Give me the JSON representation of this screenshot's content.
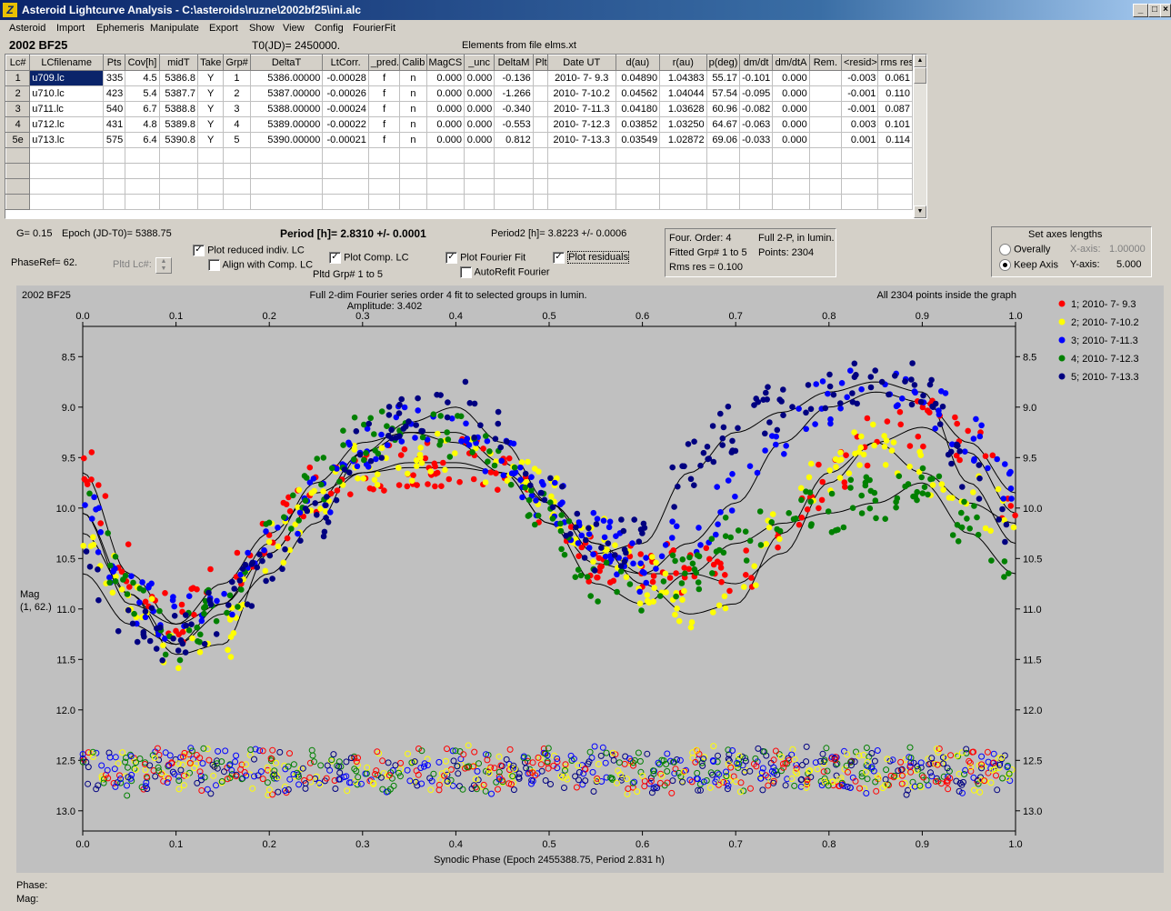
{
  "window": {
    "title": "Asteroid Lightcurve Analysis - C:\\asteroids\\ruzne\\2002bf25\\ini.alc",
    "icon": "app-icon",
    "minimize": "_",
    "maximize": "□",
    "close": "×"
  },
  "menu": [
    "Asteroid",
    "Import",
    "Ephemeris",
    "Manipulate",
    "Export",
    "Show",
    "View",
    "Config",
    "FourierFit"
  ],
  "header": {
    "asteroid": "2002 BF25",
    "t0": "T0(JD)= 2450000.",
    "elements": "Elements from file elms.xt"
  },
  "table": {
    "columns": [
      "Lc#",
      "LCfilename",
      "Pts",
      "Cov[h]",
      "midT",
      "Take",
      "Grp#",
      "DeltaT",
      "LtCorr.",
      "_pred.",
      "Calib",
      "MagCS",
      "_unc",
      "DeltaM",
      "Plt",
      "Date UT",
      "d(au)",
      "r(au)",
      "p(deg)",
      "dm/dt",
      "dm/dtA",
      "Rem.",
      "<resid>",
      "rms res"
    ],
    "rows": [
      [
        "1",
        "u709.lc",
        "335",
        "4.5",
        "5386.8",
        "Y",
        "1",
        "5386.00000",
        "-0.00028",
        "f",
        "n",
        "0.000",
        "0.000",
        "-0.136",
        "",
        "2010- 7- 9.3",
        "0.04890",
        "1.04383",
        "55.17",
        "-0.101",
        "0.000",
        "",
        "-0.003",
        "0.061"
      ],
      [
        "2",
        "u710.lc",
        "423",
        "5.4",
        "5387.7",
        "Y",
        "2",
        "5387.00000",
        "-0.00026",
        "f",
        "n",
        "0.000",
        "0.000",
        "-1.266",
        "",
        "2010- 7-10.2",
        "0.04562",
        "1.04044",
        "57.54",
        "-0.095",
        "0.000",
        "",
        "-0.001",
        "0.110"
      ],
      [
        "3",
        "u711.lc",
        "540",
        "6.7",
        "5388.8",
        "Y",
        "3",
        "5388.00000",
        "-0.00024",
        "f",
        "n",
        "0.000",
        "0.000",
        "-0.340",
        "",
        "2010- 7-11.3",
        "0.04180",
        "1.03628",
        "60.96",
        "-0.082",
        "0.000",
        "",
        "-0.001",
        "0.087"
      ],
      [
        "4",
        "u712.lc",
        "431",
        "4.8",
        "5389.8",
        "Y",
        "4",
        "5389.00000",
        "-0.00022",
        "f",
        "n",
        "0.000",
        "0.000",
        "-0.553",
        "",
        "2010- 7-12.3",
        "0.03852",
        "1.03250",
        "64.67",
        "-0.063",
        "0.000",
        "",
        "0.003",
        "0.101"
      ],
      [
        "5e",
        "u713.lc",
        "575",
        "6.4",
        "5390.8",
        "Y",
        "5",
        "5390.00000",
        "-0.00021",
        "f",
        "n",
        "0.000",
        "0.000",
        "0.812",
        "",
        "2010- 7-13.3",
        "0.03549",
        "1.02872",
        "69.06",
        "-0.033",
        "0.000",
        "",
        "0.001",
        "0.114"
      ]
    ],
    "empty_rows": 4
  },
  "controls": {
    "g": "G= 0.15",
    "epoch": "Epoch (JD-T0)= 5388.75",
    "period": "Period [h]= 2.8310 +/- 0.0001",
    "period2": "Period2 [h]= 3.8223 +/- 0.0006",
    "phaseref": "PhaseRef= 62.",
    "pltd_lc": "Pltd Lc#:",
    "plot_reduced": "Plot reduced indiv. LC",
    "align_comp": "Align with Comp. LC",
    "plot_comp": "Plot Comp. LC",
    "pltd_grp": "Pltd Grp#  1   to   5",
    "plot_fourier": "Plot Fourier Fit",
    "autorefit": "AutoRefit Fourier",
    "plot_residuals": "Plot residuals",
    "four_order": "Four. Order:  4",
    "full2p": "Full 2-P, in lumin.",
    "fitted": "Fitted Grp# 1 to 5",
    "points": "Points: 2304",
    "rms": "Rms res      = 0.100",
    "axes_title": "Set axes lengths",
    "overally": "Overally",
    "keep_axis": "Keep Axis",
    "xaxis_label": "X-axis:",
    "xaxis_val": "1.00000",
    "yaxis_label": "Y-axis:",
    "yaxis_val": "5.000"
  },
  "footer": {
    "phase": "Phase:",
    "mag": "Mag:"
  },
  "chart_data": {
    "type": "scatter",
    "corner_label": "2002 BF25",
    "title": "Full 2-dim Fourier series order 4 fit to selected groups in lumin.",
    "subtitle": "Amplitude: 3.402",
    "note": "All 2304 points inside the graph",
    "xlabel": "Synodic Phase (Epoch 2455388.75, Period 2.831 h)",
    "ylabel": "Mag\n(1, 62.)",
    "xlim": [
      0.0,
      1.0
    ],
    "ylim": [
      13.2,
      8.2
    ],
    "x_ticks": [
      "0.0",
      "0.1",
      "0.2",
      "0.3",
      "0.4",
      "0.5",
      "0.6",
      "0.7",
      "0.8",
      "0.9",
      "1.0"
    ],
    "y_ticks": [
      "8.5",
      "9.0",
      "9.5",
      "10.0",
      "10.5",
      "11.0",
      "11.5",
      "12.0",
      "12.5",
      "13.0"
    ],
    "residual_level": 12.6,
    "series": [
      {
        "name": "1; 2010- 7- 9.3",
        "color": "#ff0000",
        "x": [
          0.0,
          0.05,
          0.1,
          0.15,
          0.2,
          0.25,
          0.3,
          0.35,
          0.4,
          0.45,
          0.5,
          0.55,
          0.6,
          0.65,
          0.7,
          0.75,
          0.8,
          0.85,
          0.9,
          0.95,
          1.0
        ],
        "y": [
          9.6,
          10.6,
          11.1,
          10.7,
          10.2,
          9.8,
          9.6,
          9.55,
          9.55,
          9.6,
          10.1,
          10.5,
          10.6,
          10.6,
          10.7,
          10.4,
          9.7,
          9.3,
          9.15,
          9.4,
          10.0
        ]
      },
      {
        "name": "2; 2010- 7-10.2",
        "color": "#ffff00",
        "x": [
          0.0,
          0.05,
          0.1,
          0.15,
          0.2,
          0.25,
          0.3,
          0.35,
          0.4,
          0.45,
          0.5,
          0.55,
          0.6,
          0.65,
          0.7,
          0.75,
          0.8,
          0.85,
          0.9,
          0.95,
          1.0
        ],
        "y": [
          10.2,
          10.8,
          11.4,
          11.3,
          10.4,
          9.9,
          9.6,
          9.5,
          9.5,
          9.6,
          9.9,
          10.3,
          10.7,
          11.0,
          10.9,
          10.2,
          9.6,
          9.3,
          9.6,
          9.9,
          10.1
        ]
      },
      {
        "name": "3; 2010- 7-11.3",
        "color": "#0000ff",
        "x": [
          0.0,
          0.05,
          0.1,
          0.15,
          0.2,
          0.25,
          0.3,
          0.35,
          0.4,
          0.45,
          0.5,
          0.55,
          0.6,
          0.65,
          0.7,
          0.75,
          0.8,
          0.85,
          0.9,
          0.95,
          1.0
        ],
        "y": [
          10.0,
          10.9,
          11.1,
          10.9,
          10.4,
          9.9,
          9.4,
          9.2,
          9.2,
          9.5,
          9.9,
          10.3,
          10.6,
          10.3,
          9.9,
          9.3,
          8.95,
          8.8,
          8.9,
          9.3,
          9.8
        ]
      },
      {
        "name": "4; 2010- 7-12.3",
        "color": "#008000",
        "x": [
          0.0,
          0.05,
          0.1,
          0.15,
          0.2,
          0.25,
          0.3,
          0.35,
          0.4,
          0.45,
          0.5,
          0.55,
          0.6,
          0.65,
          0.7,
          0.75,
          0.8,
          0.85,
          0.9,
          0.95,
          1.0
        ],
        "y": [
          10.0,
          10.8,
          11.3,
          10.9,
          10.3,
          9.7,
          9.3,
          9.2,
          9.3,
          9.6,
          10.1,
          10.7,
          10.9,
          10.6,
          10.3,
          10.1,
          10.0,
          9.9,
          9.7,
          10.2,
          10.6
        ]
      },
      {
        "name": "5; 2010- 7-13.3",
        "color": "#000080",
        "x": [
          0.0,
          0.05,
          0.1,
          0.15,
          0.2,
          0.25,
          0.3,
          0.35,
          0.4,
          0.45,
          0.5,
          0.55,
          0.6,
          0.65,
          0.7,
          0.75,
          0.8,
          0.85,
          0.9,
          0.95,
          1.0
        ],
        "y": [
          10.6,
          11.1,
          11.3,
          11.0,
          10.6,
          10.1,
          9.4,
          9.1,
          8.95,
          9.3,
          9.9,
          10.4,
          10.3,
          9.6,
          9.2,
          9.0,
          8.8,
          8.7,
          8.8,
          9.7,
          10.3
        ]
      }
    ]
  }
}
